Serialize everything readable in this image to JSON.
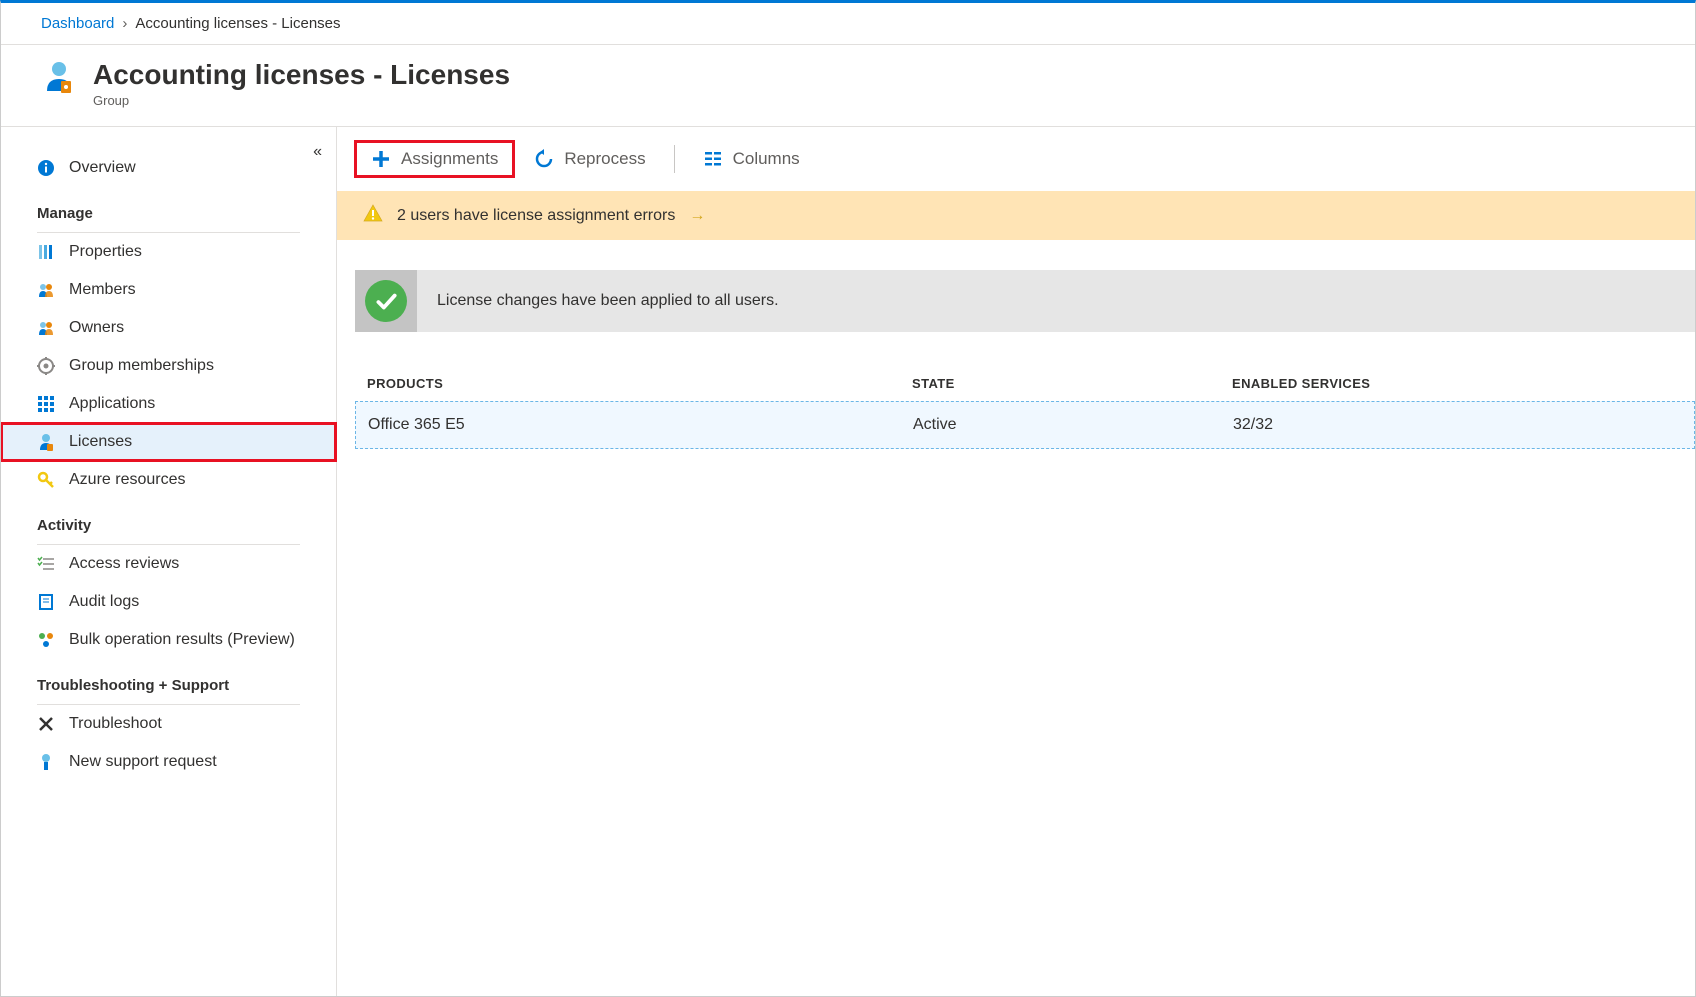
{
  "breadcrumb": {
    "dashboard": "Dashboard",
    "current": "Accounting licenses - Licenses"
  },
  "header": {
    "title": "Accounting licenses - Licenses",
    "subtitle": "Group"
  },
  "sidebar": {
    "overview": "Overview",
    "sections": {
      "manage": "Manage",
      "activity": "Activity",
      "support": "Troubleshooting + Support"
    },
    "items": {
      "properties": "Properties",
      "members": "Members",
      "owners": "Owners",
      "groupMemberships": "Group memberships",
      "applications": "Applications",
      "licenses": "Licenses",
      "azureResources": "Azure resources",
      "accessReviews": "Access reviews",
      "auditLogs": "Audit logs",
      "bulkOps": "Bulk operation results (Preview)",
      "troubleshoot": "Troubleshoot",
      "newSupport": "New support request"
    }
  },
  "toolbar": {
    "assignments": "Assignments",
    "reprocess": "Reprocess",
    "columns": "Columns"
  },
  "warning": {
    "text": "2 users have license assignment errors"
  },
  "success": {
    "text": "License changes have been applied to all users."
  },
  "table": {
    "headers": {
      "products": "PRODUCTS",
      "state": "STATE",
      "services": "ENABLED SERVICES"
    },
    "rows": [
      {
        "product": "Office 365 E5",
        "state": "Active",
        "services": "32/32"
      }
    ]
  }
}
